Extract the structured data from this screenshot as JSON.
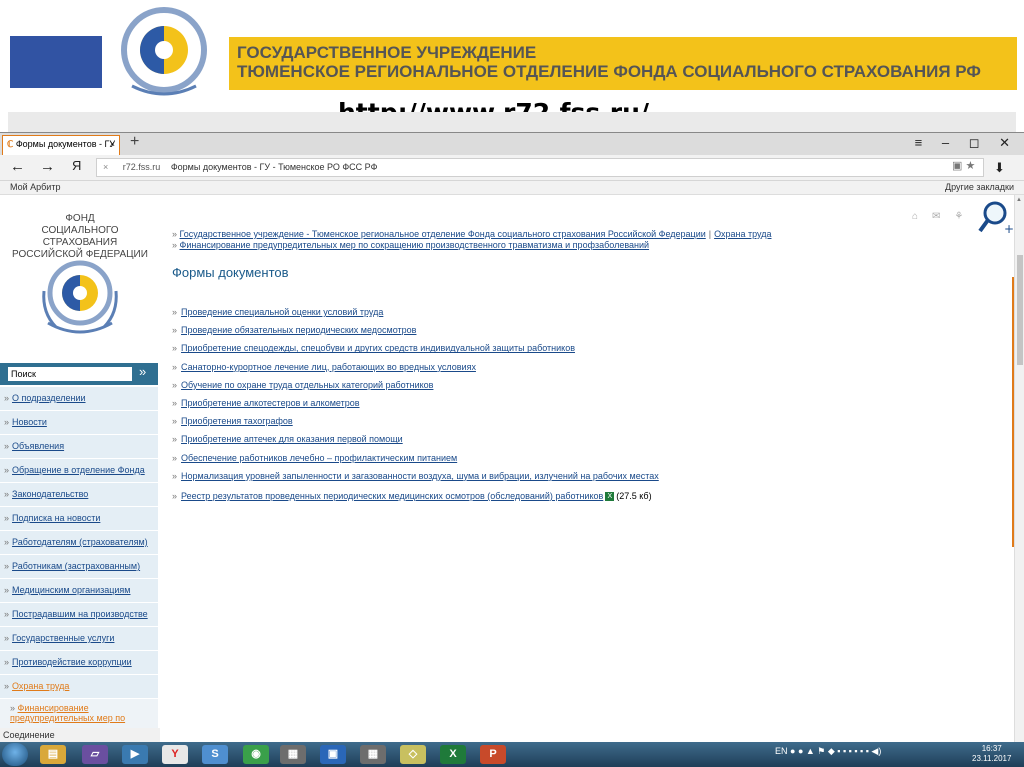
{
  "slide": {
    "title_line1": "ГОСУДАРСТВЕННОЕ УЧРЕЖДЕНИЕ",
    "title_line2": "ТЮМЕНСКОЕ РЕГИОНАЛЬНОЕ ОТДЕЛЕНИЕ ФОНДА СОЦИАЛЬНОГО СТРАХОВАНИЯ РФ",
    "url_underlined": "http://www.r72.fss.ru",
    "url_suffix": "/"
  },
  "browser": {
    "tab_title": "Формы документов - ГУ",
    "tab_close": "×",
    "new_tab": "+",
    "window_controls": "≡ – ◻ ✕",
    "nav_back": "←",
    "nav_forward": "→",
    "nav_home": "Я",
    "address_clear": "×",
    "address_domain": "r72.fss.ru",
    "address_title": "Формы документов - ГУ - Тюменское РО ФСС РФ",
    "bookmark_left": "Мой Арбитр",
    "bookmark_right": "Другие закладки",
    "status": "Соединение"
  },
  "sidebar": {
    "org_line1": "ФОНД",
    "org_line2": "СОЦИАЛЬНОГО СТРАХОВАНИЯ",
    "org_line3": "РОССИЙСКОЙ ФЕДЕРАЦИИ",
    "search_placeholder": "Поиск",
    "search_go": "»",
    "items": [
      {
        "label": "О подразделении"
      },
      {
        "label": "Новости"
      },
      {
        "label": "Объявления"
      },
      {
        "label": "Обращение в отделение Фонда"
      },
      {
        "label": "Законодательство"
      },
      {
        "label": "Подписка на новости"
      },
      {
        "label": "Работодателям (страхователям)"
      },
      {
        "label": "Работникам (застрахованным)"
      },
      {
        "label": "Медицинским организациям"
      },
      {
        "label": "Пострадавшим на производстве"
      },
      {
        "label": "Государственные услуги"
      },
      {
        "label": "Противодействие коррупции"
      },
      {
        "label": "Охрана труда"
      }
    ],
    "submenu_label": "Финансирование предупредительных мер по"
  },
  "content": {
    "breadcrumb_1": "Государственное учреждение - Тюменское региональное отделение Фонда социального страхования Российской Федерации",
    "breadcrumb_2": "Охрана труда",
    "breadcrumb_3": "Финансирование предупредительных мер по сокращению производственного травматизма и профзаболеваний",
    "page_title": "Формы документов",
    "documents": [
      {
        "label": "Проведение специальной оценки условий труда"
      },
      {
        "label": "Проведение обязательных периодических медосмотров"
      },
      {
        "label": "Приобретение спецодежды, спецобуви и других средств индивидуальной защиты работников"
      },
      {
        "label": "Санаторно-курортное лечение лиц, работающих во вредных условиях"
      },
      {
        "label": "Обучение по охране труда отдельных категорий работников"
      },
      {
        "label": "Приобретение алкотестеров и алкометров"
      },
      {
        "label": "Приобретения тахографов"
      },
      {
        "label": "Приобретение аптечек для оказания первой помощи"
      },
      {
        "label": "Обеспечение работников лечебно – профилактическим питанием"
      },
      {
        "label": "Нормализация уровней запыленности и загазованности воздуха, шума и вибрации, излучений на рабочих местах"
      }
    ],
    "registry_label": "Реестр результатов проведенных периодических медицинских осмотров (обследований) работников",
    "registry_size": "(27.5 кб)"
  },
  "taskbar": {
    "lang": "EN",
    "time": "16:37",
    "date": "23.11.2017"
  },
  "colors": {
    "accent_orange": "#e07b1a",
    "banner_yellow": "#f3c21a",
    "slide_blue": "#3153a3",
    "link_blue": "#1a4a8a",
    "menu_bg": "#e4eef5"
  }
}
